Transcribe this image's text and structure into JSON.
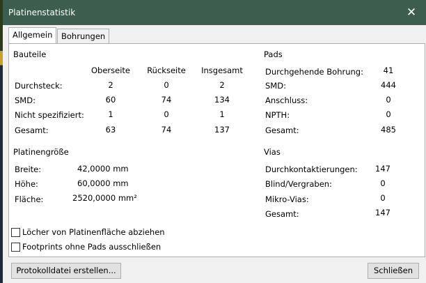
{
  "window": {
    "title": "Platinenstatistik",
    "close_glyph": "✕"
  },
  "tabs": [
    {
      "label": "Allgemein",
      "active": true
    },
    {
      "label": "Bohrungen",
      "active": false
    }
  ],
  "bauteile": {
    "heading": "Bauteile",
    "columns": [
      "Oberseite",
      "Rückseite",
      "Insgesamt"
    ],
    "rows": [
      {
        "label": "Durchsteck:",
        "values": [
          "2",
          "0",
          "2"
        ]
      },
      {
        "label": "SMD:",
        "values": [
          "60",
          "74",
          "134"
        ]
      },
      {
        "label": "Nicht spezifiziert:",
        "values": [
          "1",
          "0",
          "1"
        ]
      },
      {
        "label": "Gesamt:",
        "values": [
          "63",
          "74",
          "137"
        ]
      }
    ]
  },
  "pads": {
    "heading": "Pads",
    "rows": [
      {
        "label": "Durchgehende Bohrung:",
        "value": "41"
      },
      {
        "label": "SMD:",
        "value": "444"
      },
      {
        "label": "Anschluss:",
        "value": "0"
      },
      {
        "label": "NPTH:",
        "value": "0"
      },
      {
        "label": "Gesamt:",
        "value": "485"
      }
    ]
  },
  "platinengroesse": {
    "heading": "Platinengröße",
    "rows": [
      {
        "label": "Breite:",
        "value": "42,0000 mm"
      },
      {
        "label": "Höhe:",
        "value": "60,0000 mm"
      },
      {
        "label": "Fläche:",
        "value": "2520,0000 mm²"
      }
    ]
  },
  "vias": {
    "heading": "Vias",
    "rows": [
      {
        "label": "Durchkontaktierungen:",
        "value": "147"
      },
      {
        "label": "Blind/Vergraben:",
        "value": "0"
      },
      {
        "label": "Mikro-Vias:",
        "value": "0"
      },
      {
        "label": "Gesamt:",
        "value": "147"
      }
    ]
  },
  "options": [
    {
      "label": "Löcher von Platinenfläche abziehen",
      "checked": false
    },
    {
      "label": "Footprints ohne Pads ausschließen",
      "checked": false
    }
  ],
  "buttons": {
    "report": "Protokolldatei erstellen...",
    "close": "Schließen"
  },
  "colors": {
    "titlebar": "#3d5d4f",
    "dialog_bg": "#f0f0f0",
    "panel_bg": "#ffffff"
  }
}
